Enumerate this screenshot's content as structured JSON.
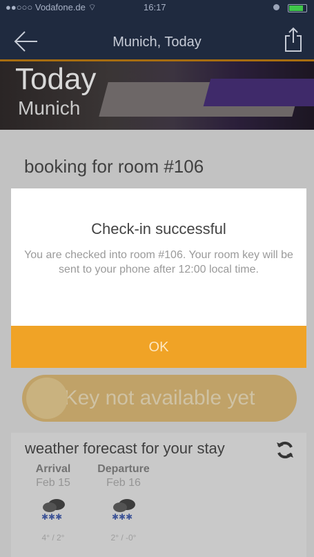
{
  "status_bar": {
    "carrier": "●●○○○ Vodafone.de ⌔",
    "time": "16:17"
  },
  "nav": {
    "title": "Munich, Today"
  },
  "hero": {
    "title": "Today",
    "city": "Munich"
  },
  "booking": {
    "label": "booking for room #106"
  },
  "dialog": {
    "title": "Check-in successful",
    "message": "You are checked into room #106. Your room key will be sent to your phone after 12:00 local time.",
    "ok_label": "OK"
  },
  "key_button": {
    "label": "Key not available yet"
  },
  "weather": {
    "title": "weather forecast for your stay",
    "arrival": {
      "label": "Arrival",
      "date": "Feb 15",
      "temp": "4° / 2°"
    },
    "departure": {
      "label": "Departure",
      "date": "Feb 16",
      "temp": "2° / -0°"
    }
  },
  "colors": {
    "nav_bg": "#1f2a3f",
    "accent": "#f0a326"
  },
  "icons": {
    "back": "back-arrow-icon",
    "share": "share-icon",
    "refresh": "refresh-icon",
    "weather": "snow-cloud-icon"
  }
}
